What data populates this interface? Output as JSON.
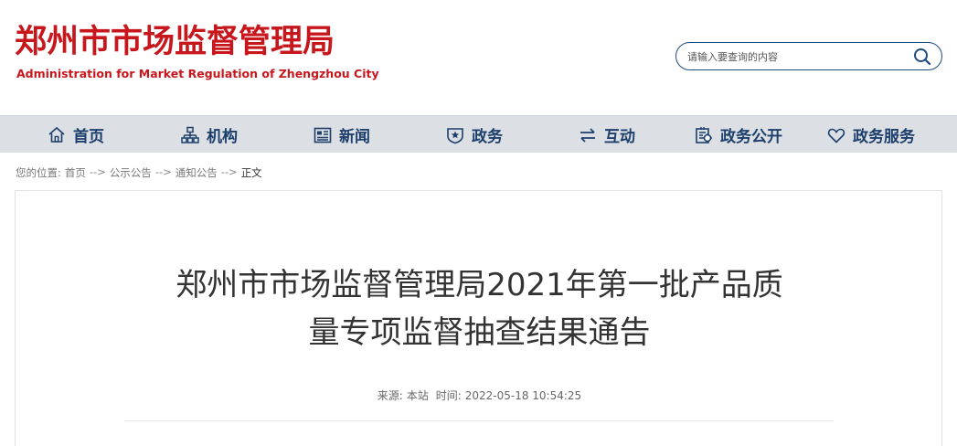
{
  "header": {
    "logo_cn": "郑州市市场监督管理局",
    "logo_en": "Administration for Market Regulation of Zhengzhou City"
  },
  "search": {
    "placeholder": "请输入要查询的内容",
    "button_icon": "search-icon"
  },
  "nav": {
    "items": [
      {
        "label": "首页",
        "icon": "home-icon"
      },
      {
        "label": "机构",
        "icon": "org-chart-icon"
      },
      {
        "label": "新闻",
        "icon": "newspaper-icon"
      },
      {
        "label": "政务",
        "icon": "emblem-icon"
      },
      {
        "label": "互动",
        "icon": "swap-arrows-icon"
      },
      {
        "label": "政务公开",
        "icon": "open-affairs-icon"
      },
      {
        "label": "政务服务",
        "icon": "heart-icon"
      }
    ],
    "colors": {
      "background": "#dcdfe3",
      "text": "#1c3f6b"
    }
  },
  "breadcrumb": {
    "prefix": "您的位置:",
    "items": [
      "首页",
      "公示公告",
      "通知公告"
    ],
    "separator": "-->",
    "current": "正文"
  },
  "article": {
    "title_line1": "郑州市市场监督管理局2021年第一批产品质",
    "title_line2": "量专项监督抽查结果通告",
    "source_label": "来源:",
    "source": "本站",
    "time_label": "时间:",
    "time": "2022-05-18 10:54:25"
  },
  "colors": {
    "brand_red": "#c8161d",
    "accent_blue": "#1d4a7f"
  }
}
